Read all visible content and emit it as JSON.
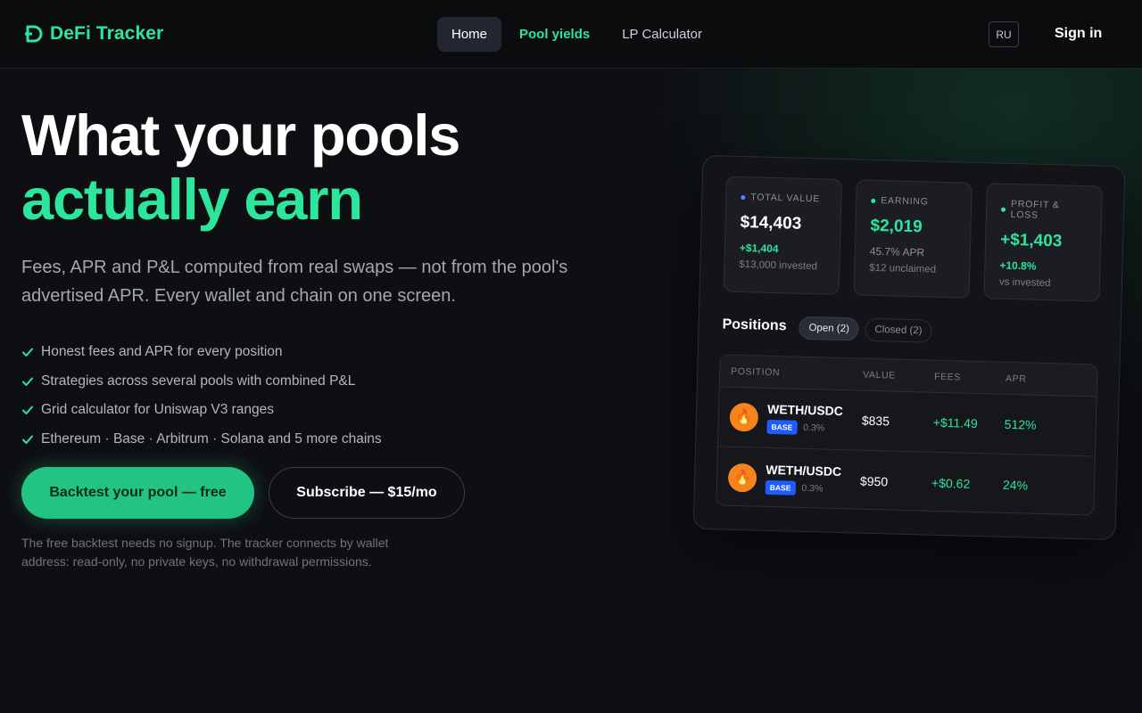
{
  "header": {
    "brand": "DeFi Tracker",
    "nav": [
      {
        "label": "Home",
        "active": true
      },
      {
        "label": "Pool yields",
        "accent": true
      },
      {
        "label": "LP Calculator"
      }
    ],
    "lang": "RU",
    "signin": "Sign in"
  },
  "hero": {
    "title_line1": "What your pools",
    "title_line2": "actually earn",
    "subtitle": "Fees, APR and P&L computed from real swaps — not from the pool's advertised APR. Every wallet and chain on one screen.",
    "features": [
      "Honest fees and APR for every position",
      "Strategies across several pools with combined P&L",
      "Grid calculator for Uniswap V3 ranges",
      "Ethereum · Base · Arbitrum · Solana and 5 more chains"
    ],
    "cta_primary": "Backtest your pool — free",
    "cta_secondary": "Subscribe — $15/mo",
    "note": "The free backtest needs no signup. The tracker connects by wallet address: read-only, no private keys, no withdrawal permissions."
  },
  "dashboard": {
    "stats": [
      {
        "label": "TOTAL VALUE",
        "dot_color": "#4f8dff",
        "value": "$14,403",
        "value_green": false,
        "sub1": "+$1,404",
        "sub1_green": true,
        "sub2": "$13,000 invested"
      },
      {
        "label": "EARNING",
        "dot_color": "#2ee59d",
        "value": "$2,019",
        "value_green": true,
        "sub1": "45.7% APR",
        "sub1_green": false,
        "sub2": "$12 unclaimed"
      },
      {
        "label": "PROFIT & LOSS",
        "dot_color": "#2ee59d",
        "value": "+$1,403",
        "value_green": true,
        "sub1": "+10.8%",
        "sub1_green": true,
        "sub2": "vs invested"
      }
    ],
    "positions_title": "Positions",
    "tabs": [
      {
        "label": "Open (2)",
        "active": true
      },
      {
        "label": "Closed (2)",
        "active": false
      }
    ],
    "table": {
      "headers": {
        "position": "POSITION",
        "value": "VALUE",
        "fees": "FEES",
        "apr": "APR"
      },
      "rows": [
        {
          "pair": "WETH/USDC",
          "chain": "BASE",
          "fee_tier": "0.3%",
          "value": "$835",
          "fees": "+$11.49",
          "apr": "512%"
        },
        {
          "pair": "WETH/USDC",
          "chain": "BASE",
          "fee_tier": "0.3%",
          "value": "$950",
          "fees": "+$0.62",
          "apr": "24%"
        }
      ]
    }
  }
}
